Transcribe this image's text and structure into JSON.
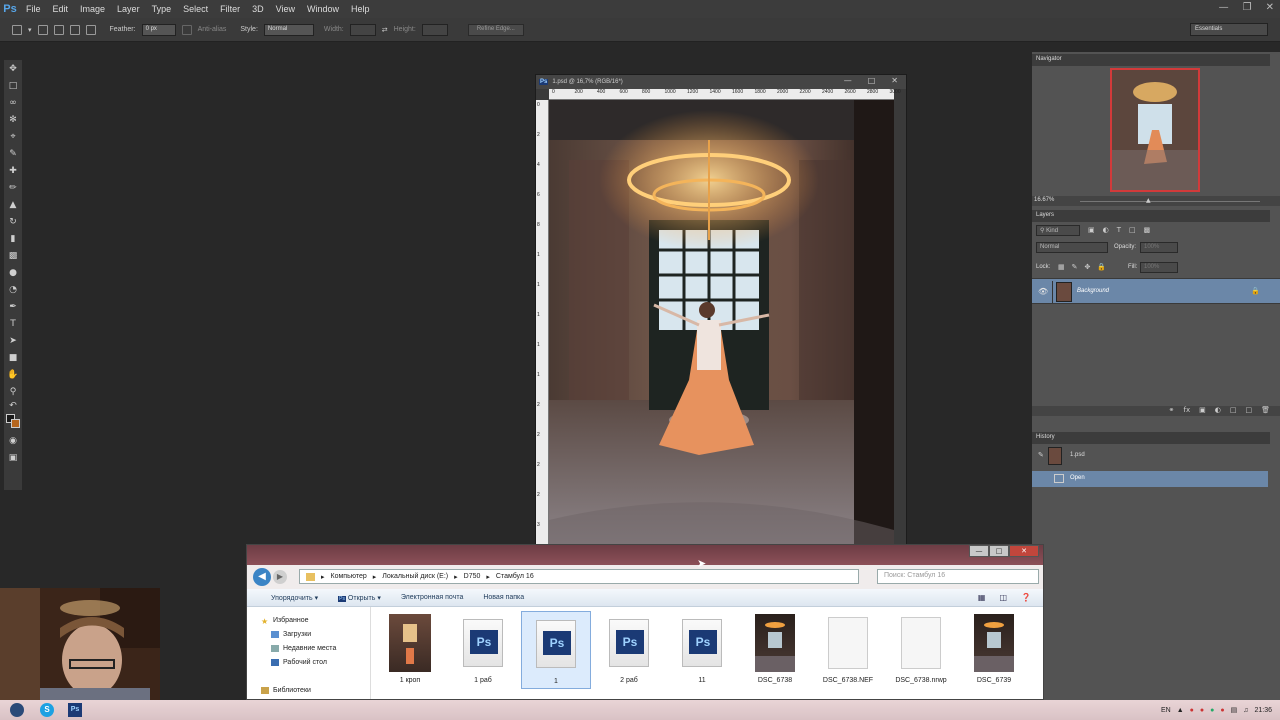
{
  "app": {
    "logo": "Ps"
  },
  "menu": [
    "File",
    "Edit",
    "Image",
    "Layer",
    "Type",
    "Select",
    "Filter",
    "3D",
    "View",
    "Window",
    "Help"
  ],
  "options": {
    "feather_label": "Feather:",
    "feather_value": "0 px",
    "antialias_label": "Anti-alias",
    "style_label": "Style:",
    "style_value": "Normal",
    "width_label": "Width:",
    "height_label": "Height:",
    "refine_label": "Refine Edge...",
    "workspace": "Essentials"
  },
  "document": {
    "title": "1.psd @ 16,7% (RGB/16*)",
    "ruler_h": [
      "0",
      "200",
      "400",
      "600",
      "800",
      "1000",
      "1200",
      "1400",
      "1600",
      "1800",
      "2000",
      "2200",
      "2400",
      "2600",
      "2800",
      "3000"
    ],
    "ruler_v": [
      "0",
      "2",
      "4",
      "6",
      "8",
      "1",
      "1",
      "1",
      "1",
      "1",
      "2",
      "2",
      "2",
      "2",
      "3"
    ]
  },
  "navigator": {
    "title": "Navigator",
    "zoom": "16.67%"
  },
  "layers": {
    "title": "Layers",
    "filter": "Kind",
    "blend": "Normal",
    "opacity_label": "Opacity:",
    "opacity_value": "100%",
    "lock_label": "Lock:",
    "fill_label": "Fill:",
    "fill_value": "100%",
    "layer_name": "Background"
  },
  "history": {
    "title": "History",
    "snapshot": "1.psd",
    "items": [
      "Open"
    ]
  },
  "explorer": {
    "path": [
      "Компьютер",
      "Локальный диск (E:)",
      "D750",
      "Стамбул 16"
    ],
    "search_placeholder": "Поиск: Стамбул 16",
    "toolbar": [
      "Упорядочить ▾",
      "Открыть ▾",
      "Электронная почта",
      "Новая папка"
    ],
    "nav": [
      "Избранное",
      "Загрузки",
      "Недавние места",
      "Рабочий стол",
      "Библиотеки"
    ],
    "files": [
      {
        "name": "1 кроп",
        "kind": "photo"
      },
      {
        "name": "1 раб",
        "kind": "psd"
      },
      {
        "name": "1",
        "kind": "psd"
      },
      {
        "name": "2 раб",
        "kind": "psd"
      },
      {
        "name": "11",
        "kind": "psd"
      },
      {
        "name": "DSC_6738",
        "kind": "photo2"
      },
      {
        "name": "DSC_6738.NEF",
        "kind": "blank"
      },
      {
        "name": "DSC_6738.nrwp",
        "kind": "blank"
      },
      {
        "name": "DSC_6739",
        "kind": "photo2"
      }
    ]
  },
  "taskbar": {
    "lang": "EN",
    "time": "21:36"
  }
}
